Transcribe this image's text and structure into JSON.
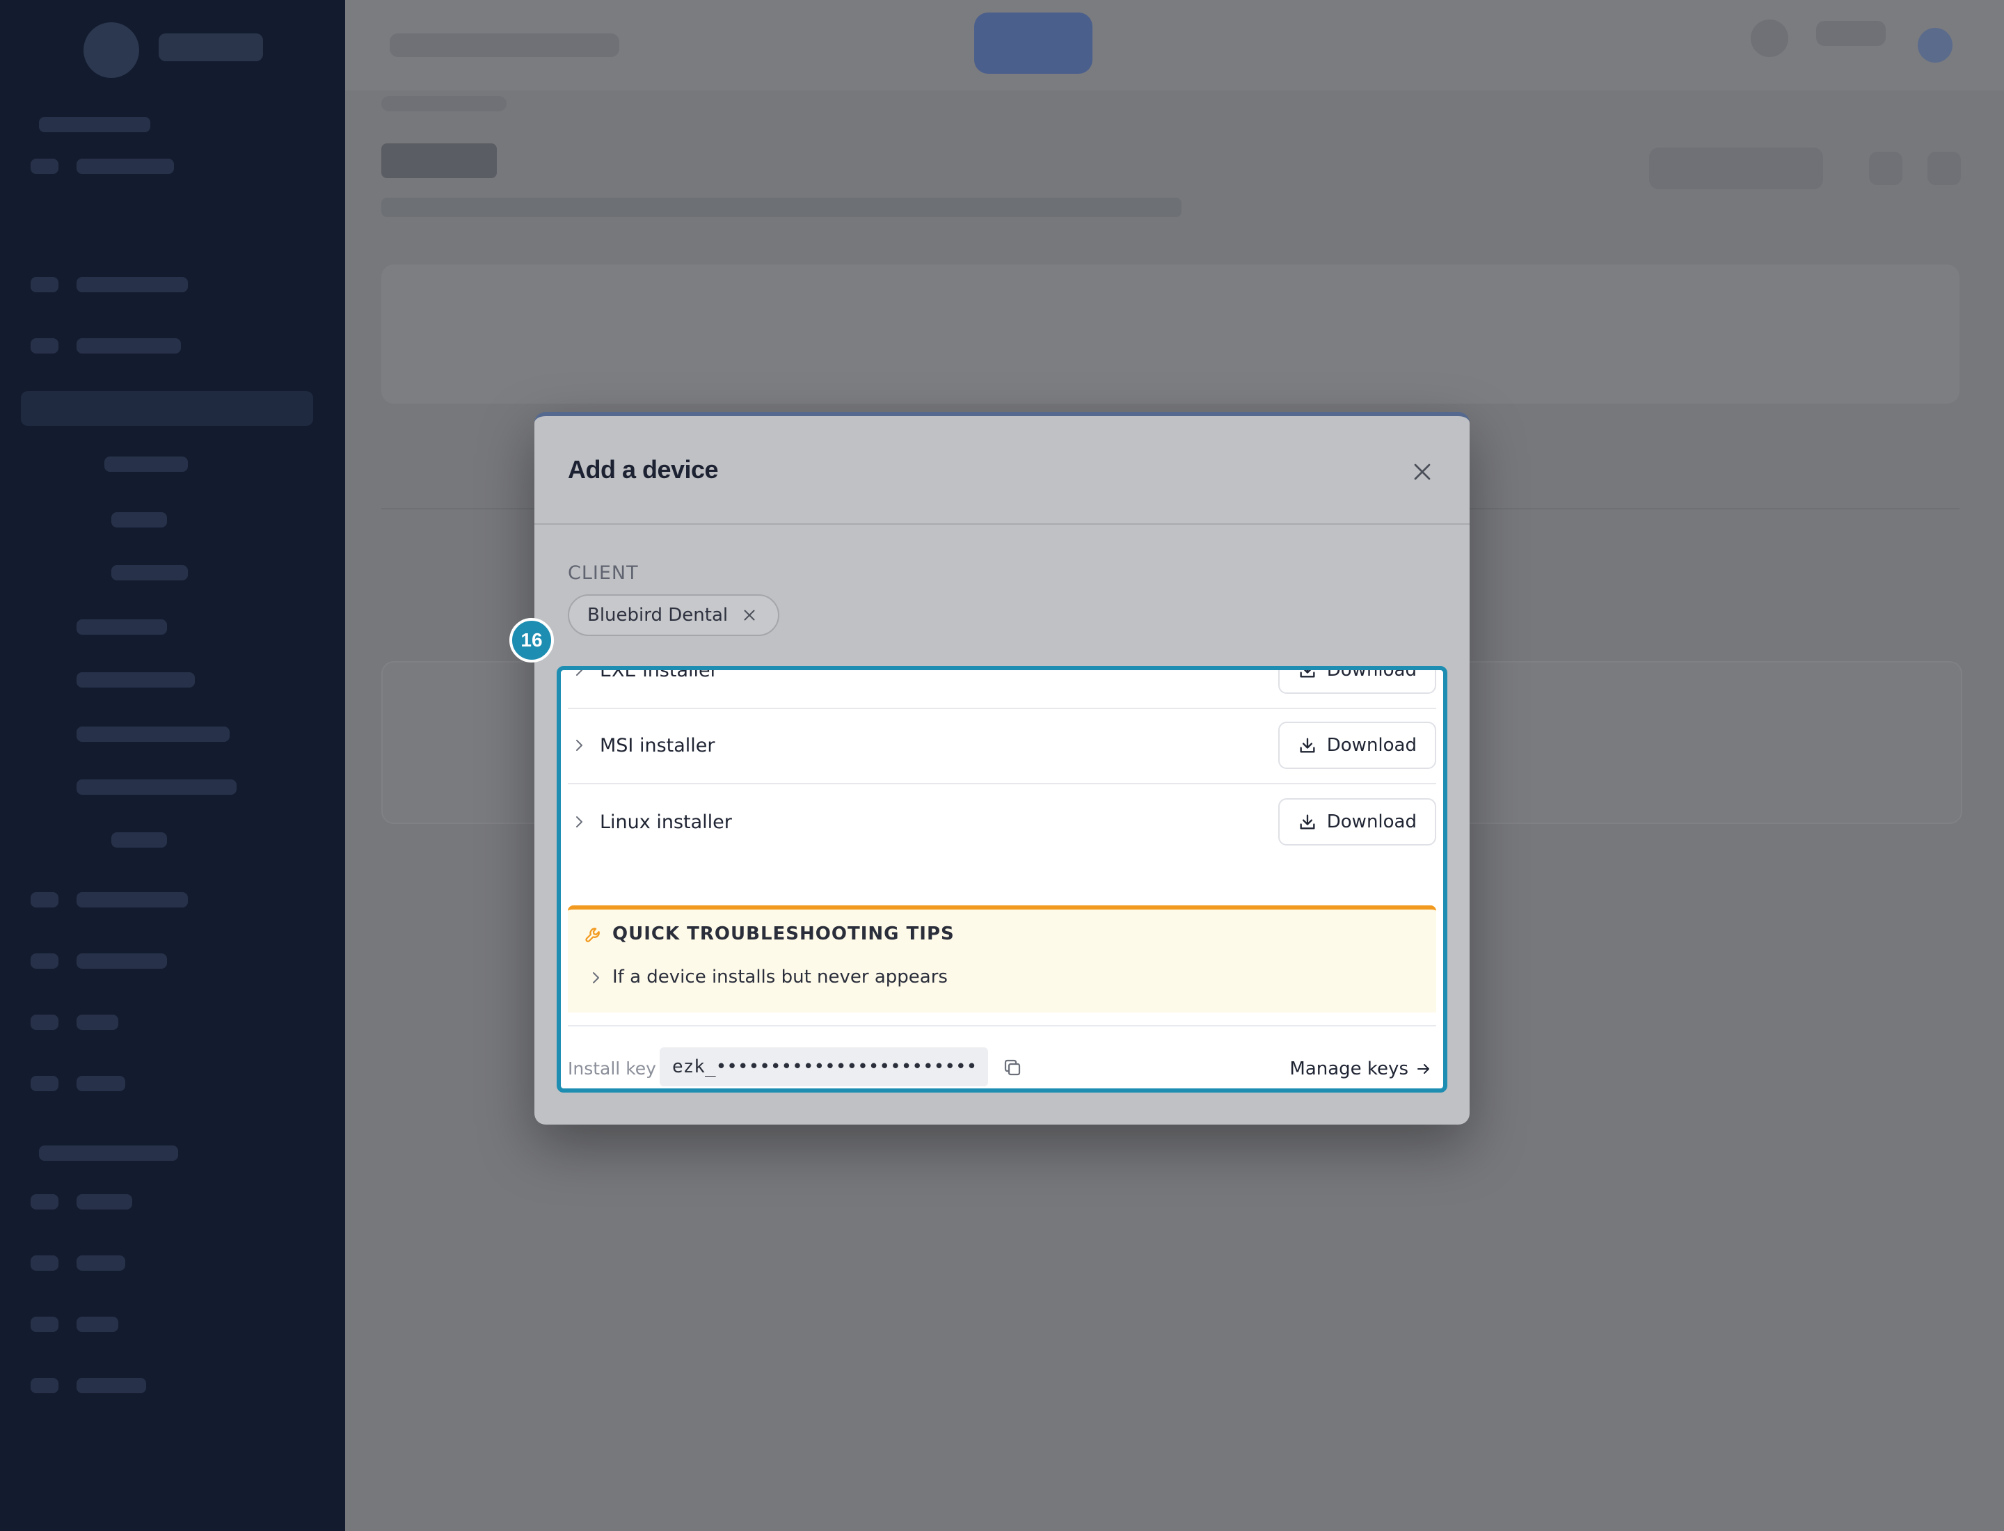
{
  "modal": {
    "title": "Add a device",
    "client_label": "CLIENT",
    "client_chip": "Bluebird Dental"
  },
  "annotation": {
    "badge": "16"
  },
  "installers": [
    {
      "label": "EXE installer",
      "button": "Download"
    },
    {
      "label": "MSI installer",
      "button": "Download"
    },
    {
      "label": "Linux installer",
      "button": "Download"
    }
  ],
  "tips": {
    "title": "QUICK TROUBLESHOOTING TIPS",
    "item": "If a device installs but never appears"
  },
  "install_key": {
    "label": "Install key",
    "value": "ezk_••••••••••••••••••••••••",
    "manage_label": "Manage keys"
  },
  "colors": {
    "highlight": "#1d8eb2",
    "tips_accent": "#f29a1f",
    "sidebar": "#131b2e"
  }
}
